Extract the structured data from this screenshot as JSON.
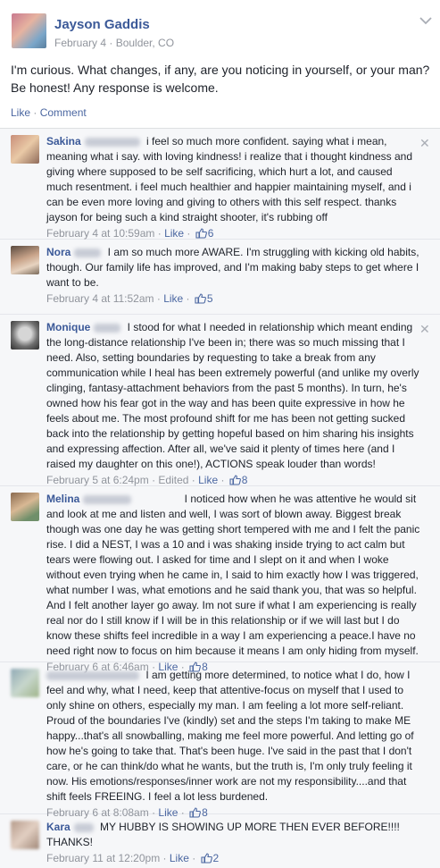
{
  "post": {
    "author": "Jayson Gaddis",
    "meta": "February 4 · Boulder, CO",
    "text": "I'm curious. What changes, if any, are you noticing in yourself, or your man? Be honest! Any response is welcome.",
    "like_label": "Like",
    "separator": " · ",
    "comment_label": "Comment",
    "chevron_icon": "chevron-down-icon"
  },
  "comments": [
    {
      "first_name": "Sakina",
      "text": "i feel so much more confident. saying what i mean, meaning what i say. with loving kindness! i realize that i thought kindness and giving where supposed to be self sacrificing, which hurt a lot, and caused much resentment. i feel much healthier and happier maintaining myself, and i can be even more loving and giving to others with this self respect. thanks jayson for being such a kind straight shooter, it's rubbing off",
      "time": "February 4 at 10:59am",
      "edited": "",
      "like_label": "Like",
      "likes": "6"
    },
    {
      "first_name": "Nora",
      "text": "I am so much more AWARE. I'm struggling with kicking old habits, though. Our family life has improved, and I'm making baby steps to get where I want to be.",
      "time": "February 4 at 11:52am",
      "edited": "",
      "like_label": "Like",
      "likes": "5"
    },
    {
      "first_name": "Monique",
      "text": "I stood for what I needed in relationship which meant ending the long-distance relationship I've been in; there was so much missing that I need. Also, setting boundaries by requesting to take a break from any communication while I heal has been extremely powerful (and unlike my overly clinging, fantasy-attachment behaviors from the past 5 months). In turn, he's owned how his fear got in the way and has been quite expressive in how he feels about me. The most profound shift for me has been not getting sucked back into the relationship by getting hopeful based on him sharing his insights and expressing affection. After all, we've said it plenty of times here (and I raised my daughter on this one!), ACTIONS speak louder than words!",
      "time": "February 5 at 6:24pm",
      "edited": "Edited",
      "like_label": "Like",
      "likes": "8"
    },
    {
      "first_name": "Melina",
      "text": "I noticed how when he was attentive he would sit and look at me and listen and well, I was sort of blown away. Biggest break though was one day he was getting short tempered with me and I felt the panic rise. I did a NEST, I was a 10 and i was shaking inside trying to act calm but tears were flowing out. I asked for time and I slept on it and when I woke without even trying when he came in, I said to him exactly how I was triggered, what number I was, what emotions and he said thank you, that was so helpful. And I felt another layer go away. Im not sure if what I am experiencing is really real nor do I still know if I will be in this relationship or if we will last but I do know these shifts feel incredible in a way I am experiencing a peace.I have no need right now to focus on him because it means I am only hiding from myself.",
      "time": "February 6 at 6:46am",
      "edited": "",
      "like_label": "Like",
      "likes": "8"
    },
    {
      "first_name": "",
      "text": "I am getting more determined, to notice what I do, how I feel and why, what I need, keep that attentive-focus on myself that I used to only shine on others, especially my man. I am feeling a lot more self-reliant. Proud of the boundaries I've (kindly) set and the steps I'm taking to make ME happy...that's all snowballing, making me feel more powerful. And letting go of how he's going to take that. That's been huge. I've said in the past that I don't care, or he can think/do what he wants, but the truth is, I'm only truly feeling it now. His emotions/responses/inner work are not my responsibility....and that shift feels FREEING. I feel a lot less burdened.",
      "time": "February 6 at 8:08am",
      "edited": "",
      "like_label": "Like",
      "likes": "8"
    },
    {
      "first_name": "Kara",
      "text": "MY HUBBY IS SHOWING UP MORE THEN EVER BEFORE!!!! THANKS!",
      "time": "February 11 at 12:20pm",
      "edited": "",
      "like_label": "Like",
      "likes": "2"
    }
  ],
  "icons": {
    "close": "close-icon",
    "thumb": "thumbs-up-icon"
  },
  "colors": {
    "link": "#3b5998",
    "meta": "#90949c",
    "comment_bg": "#f6f7f9"
  }
}
